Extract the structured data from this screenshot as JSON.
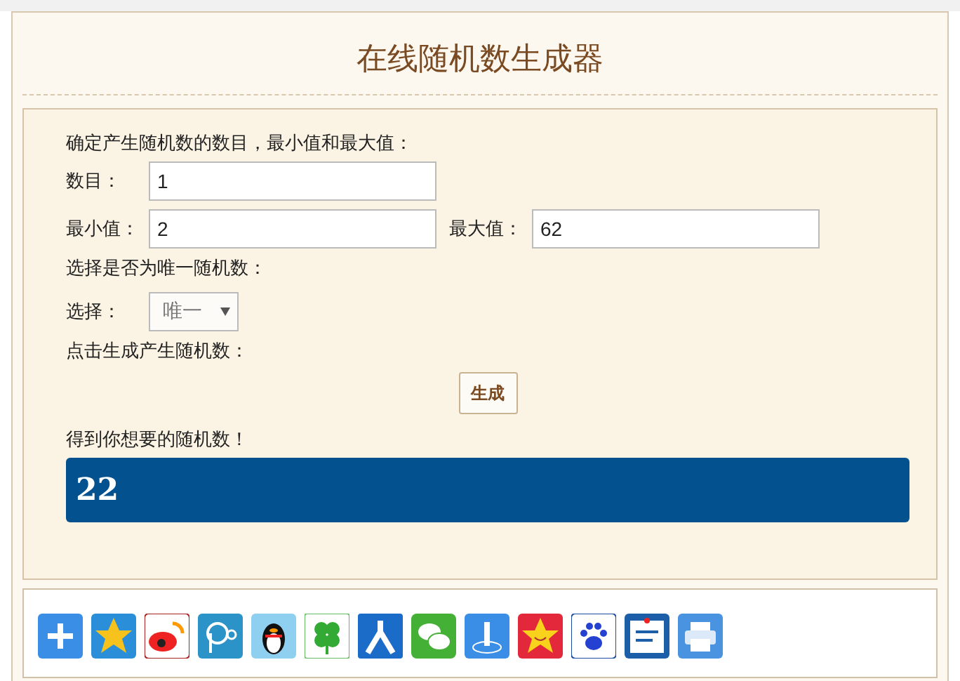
{
  "title": "在线随机数生成器",
  "form": {
    "intro": "确定产生随机数的数目，最小值和最大值：",
    "count": {
      "label": "数目：",
      "value": "1"
    },
    "min": {
      "label": "最小值：",
      "value": "2"
    },
    "max": {
      "label": "最大值：",
      "value": "62"
    },
    "unique_prompt": "选择是否为唯一随机数：",
    "choice": {
      "label": "选择：",
      "value": "唯一"
    },
    "generate_prompt": "点击生成产生随机数：",
    "generate_button": "生成",
    "result_label": "得到你想要的随机数！",
    "result": "22"
  }
}
